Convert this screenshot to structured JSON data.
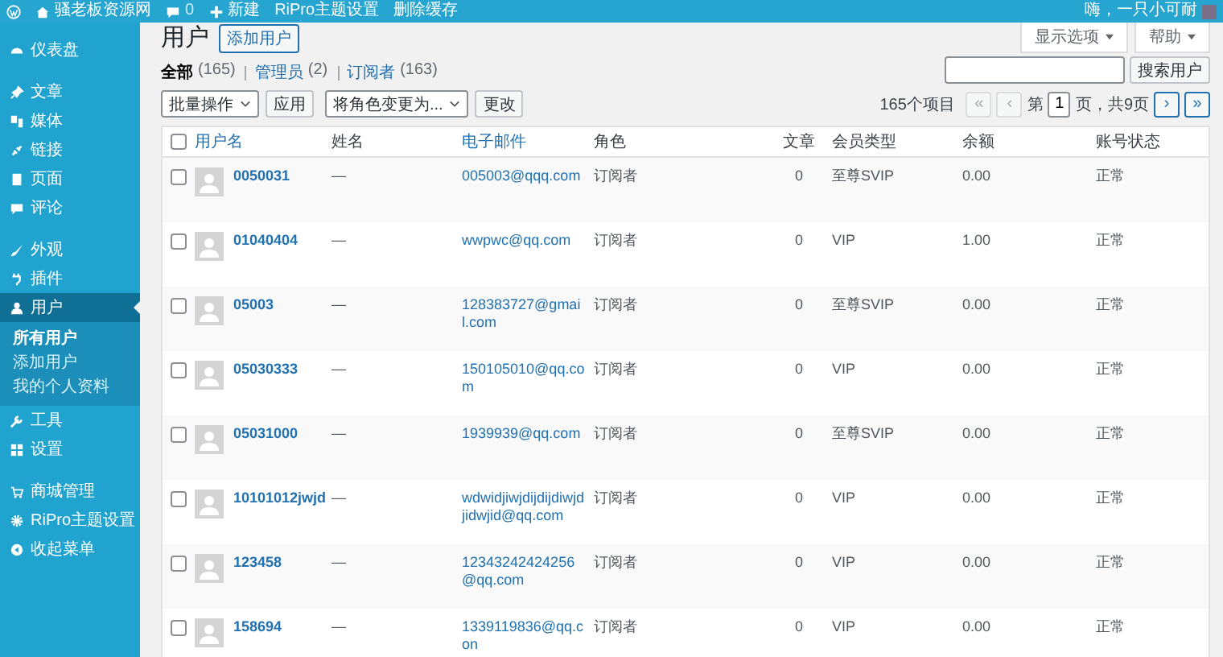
{
  "admin_bar": {
    "site_name": "骚老板资源网",
    "comments": "0",
    "new_label": "新建",
    "links": [
      "RiPro主题设置",
      "删除缓存"
    ],
    "greeting": "嗨，一只小可耐"
  },
  "sidebar": {
    "groups": [
      [
        {
          "label": "仪表盘",
          "selected": false
        }
      ],
      [
        {
          "label": "文章",
          "selected": false
        },
        {
          "label": "媒体",
          "selected": false
        },
        {
          "label": "链接",
          "selected": false
        },
        {
          "label": "页面",
          "selected": false
        },
        {
          "label": "评论",
          "selected": false
        }
      ],
      [
        {
          "label": "外观",
          "selected": false
        },
        {
          "label": "插件",
          "selected": false
        },
        {
          "label": "用户",
          "selected": true,
          "children": [
            {
              "label": "所有用户",
              "selected": true
            },
            {
              "label": "添加用户",
              "selected": false
            },
            {
              "label": "我的个人资料",
              "selected": false
            }
          ]
        },
        {
          "label": "工具",
          "selected": false
        },
        {
          "label": "设置",
          "selected": false
        }
      ],
      [
        {
          "label": "商城管理",
          "selected": false
        },
        {
          "label": "RiPro主题设置",
          "selected": false
        },
        {
          "label": "收起菜单",
          "selected": false
        }
      ]
    ]
  },
  "screen_tabs": [
    "显示选项",
    "帮助"
  ],
  "page": {
    "title": "用户",
    "add_button": "添加用户"
  },
  "filters": [
    {
      "label": "全部",
      "count": "(165)",
      "selected": true
    },
    {
      "label": "管理员",
      "count": "(2)",
      "selected": false
    },
    {
      "label": "订阅者",
      "count": "(163)",
      "selected": false
    }
  ],
  "search": {
    "button": "搜索用户"
  },
  "bulk": {
    "action": "批量操作",
    "apply": "应用",
    "role": "将角色变更为...",
    "change": "更改"
  },
  "pagination": {
    "items": "165个项目",
    "first": "«",
    "prev": "‹",
    "page_prefix": "第",
    "current": "1",
    "page_suffix": "页，共9页",
    "next": "›",
    "last": "»",
    "first_disabled": true,
    "prev_disabled": true,
    "next_disabled": false,
    "last_disabled": false
  },
  "table": {
    "select_all_checked": false,
    "columns": [
      {
        "label": "用户名",
        "sortable": true
      },
      {
        "label": "姓名",
        "sortable": false
      },
      {
        "label": "电子邮件",
        "sortable": true
      },
      {
        "label": "角色",
        "sortable": false
      },
      {
        "label": "文章",
        "sortable": false
      },
      {
        "label": "会员类型",
        "sortable": false
      },
      {
        "label": "余额",
        "sortable": false
      },
      {
        "label": "账号状态",
        "sortable": false
      }
    ],
    "rows": [
      {
        "checked": false,
        "username": "0050031",
        "name": "—",
        "email": "005003@qqq.com",
        "role": "订阅者",
        "posts": "0",
        "membership": "至尊SVIP",
        "balance": "0.00",
        "status": "正常"
      },
      {
        "checked": false,
        "username": "01040404",
        "name": "—",
        "email": "wwpwc@qq.com",
        "role": "订阅者",
        "posts": "0",
        "membership": "VIP",
        "balance": "1.00",
        "status": "正常"
      },
      {
        "checked": false,
        "username": "05003",
        "name": "—",
        "email": "128383727@gmail.com",
        "role": "订阅者",
        "posts": "0",
        "membership": "至尊SVIP",
        "balance": "0.00",
        "status": "正常"
      },
      {
        "checked": false,
        "username": "05030333",
        "name": "—",
        "email": "150105010@qq.com",
        "role": "订阅者",
        "posts": "0",
        "membership": "VIP",
        "balance": "0.00",
        "status": "正常"
      },
      {
        "checked": false,
        "username": "05031000",
        "name": "—",
        "email": "1939939@qq.com",
        "role": "订阅者",
        "posts": "0",
        "membership": "至尊SVIP",
        "balance": "0.00",
        "status": "正常"
      },
      {
        "checked": false,
        "username": "10101012jwjd",
        "name": "—",
        "email": "wdwidjiwjdijdijdiwjdjidwjid@qq.com",
        "role": "订阅者",
        "posts": "0",
        "membership": "VIP",
        "balance": "0.00",
        "status": "正常"
      },
      {
        "checked": false,
        "username": "123458",
        "name": "—",
        "email": "12343242424256@qq.com",
        "role": "订阅者",
        "posts": "0",
        "membership": "VIP",
        "balance": "0.00",
        "status": "正常"
      },
      {
        "checked": false,
        "username": "158694",
        "name": "—",
        "email": "1339119836@qq.con",
        "role": "订阅者",
        "posts": "0",
        "membership": "VIP",
        "balance": "0.00",
        "status": "正常"
      }
    ]
  }
}
